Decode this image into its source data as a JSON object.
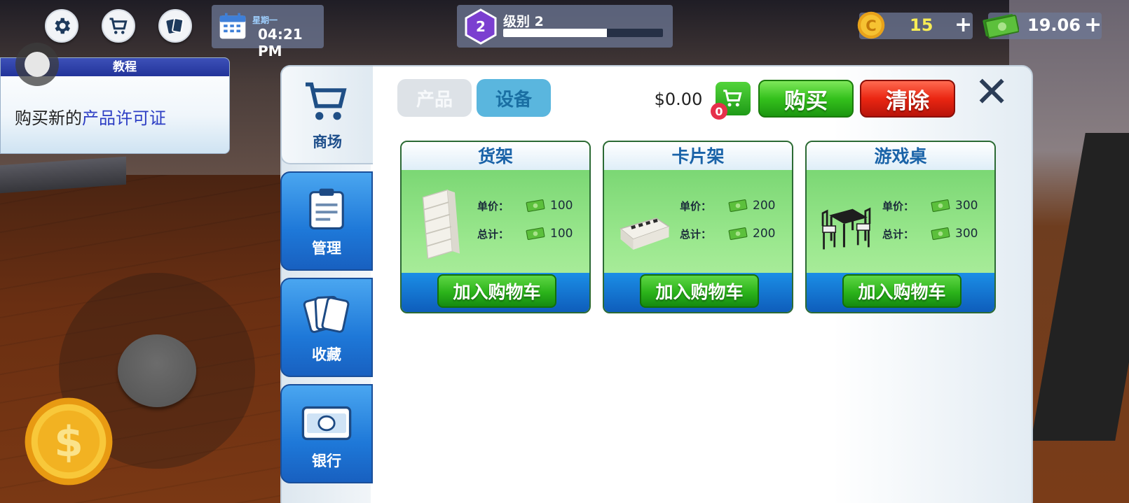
{
  "hud": {
    "icons": [
      "gear-icon",
      "cart-icon",
      "cards-icon"
    ],
    "weekday": "星期一",
    "time": "04:21 PM",
    "level_number": "2",
    "level_label": "级别 2",
    "level_progress": 0.65,
    "coins": "15",
    "cash": "19.06",
    "plus": "+"
  },
  "tutorial": {
    "title": "教程",
    "text_prefix": "购买新的",
    "text_highlight": "产品许可证"
  },
  "sidebar": {
    "tabs": [
      {
        "label": "商场",
        "icon": "cart-icon",
        "active": true
      },
      {
        "label": "管理",
        "icon": "clipboard-icon",
        "active": false
      },
      {
        "label": "收藏",
        "icon": "cards-icon",
        "active": false
      },
      {
        "label": "银行",
        "icon": "banknote-icon",
        "active": false
      }
    ]
  },
  "shop": {
    "subtabs": [
      {
        "label": "产品",
        "active": false
      },
      {
        "label": "设备",
        "active": true
      }
    ],
    "cart_total": "$0.00",
    "cart_count": "0",
    "buy_label": "购买",
    "clear_label": "清除",
    "close_label": "✕",
    "unit_price_label": "单价：",
    "total_label": "总计：",
    "add_to_cart_label": "加入购物车",
    "items": [
      {
        "name": "货架",
        "unit_price": "100",
        "total": "100",
        "icon": "shelf-icon"
      },
      {
        "name": "卡片架",
        "unit_price": "200",
        "total": "200",
        "icon": "card-rack-icon"
      },
      {
        "name": "游戏桌",
        "unit_price": "300",
        "total": "300",
        "icon": "game-table-icon"
      }
    ]
  },
  "colors": {
    "accent_blue": "#1e78d8",
    "buy_green": "#34c11c",
    "clear_red": "#ea2612",
    "coin_yellow": "#f7ec55"
  }
}
